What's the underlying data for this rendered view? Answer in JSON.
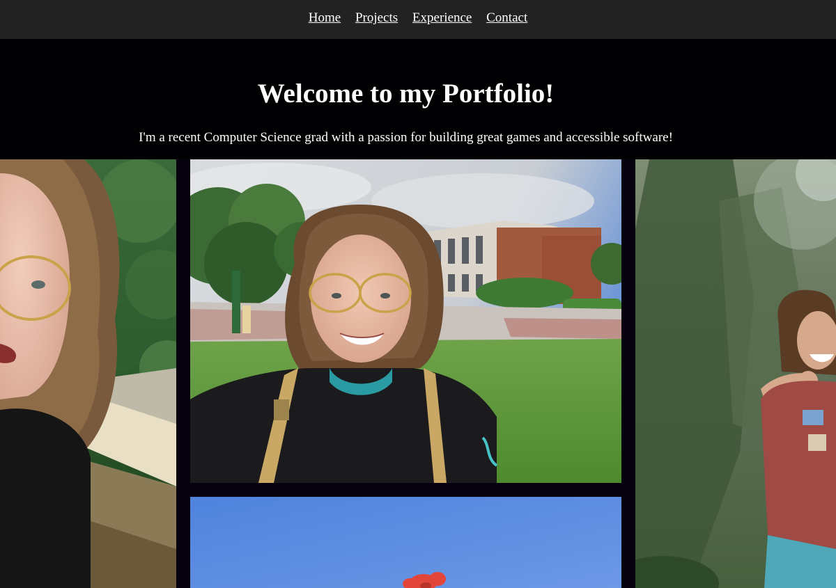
{
  "nav": {
    "links": [
      {
        "label": "Home"
      },
      {
        "label": "Projects"
      },
      {
        "label": "Experience"
      },
      {
        "label": "Contact"
      }
    ]
  },
  "hero": {
    "title": "Welcome to my Portfolio!",
    "subtitle": "I'm a recent Computer Science grad with a passion for building great games and accessible software!"
  },
  "colors": {
    "nav_bg": "#222222",
    "page_bg": "#000004",
    "text": "#ffffff"
  }
}
